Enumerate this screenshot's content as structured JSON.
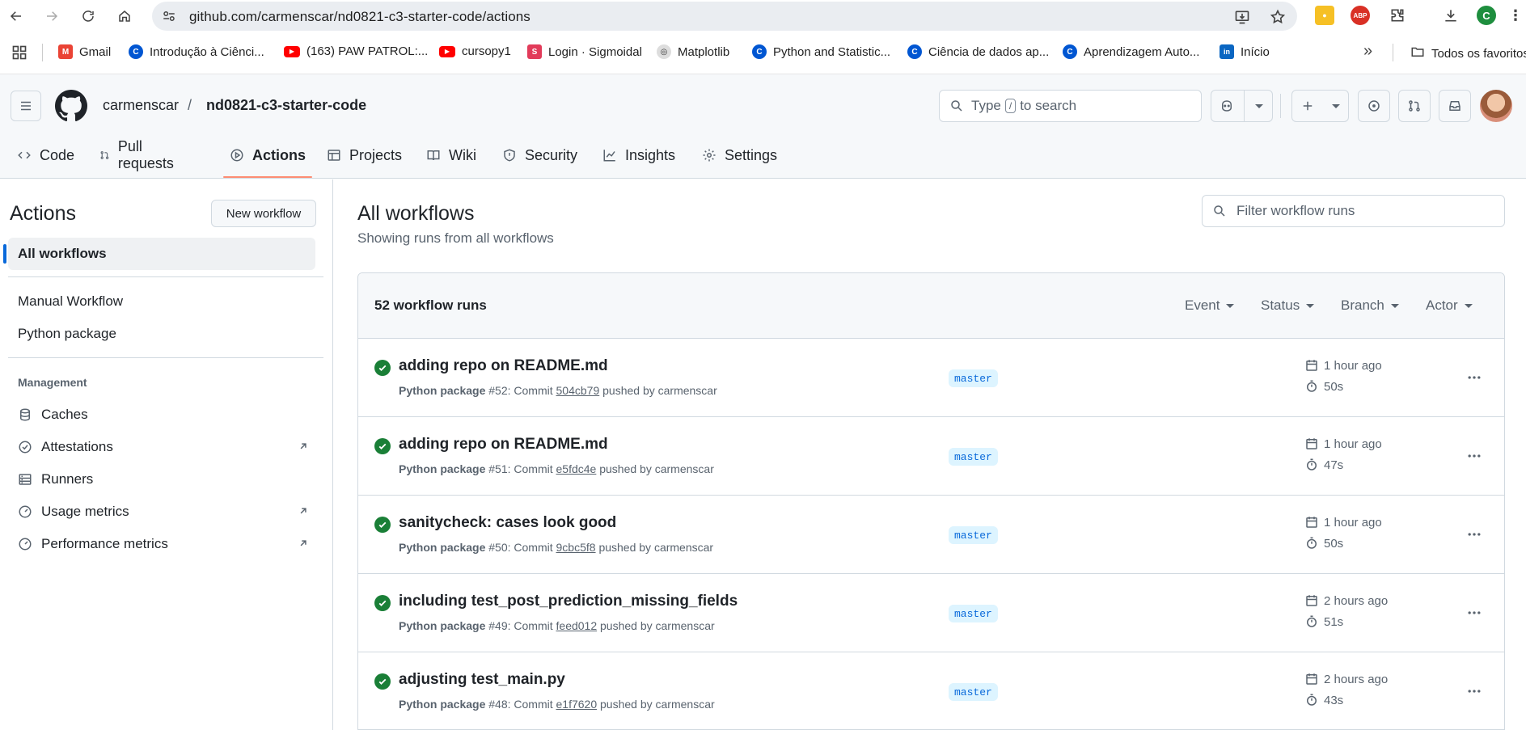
{
  "browser": {
    "url": "github.com/carmenscar/nd0821-c3-starter-code/actions",
    "profile_initial": "C",
    "bookmarks": [
      {
        "label": "Gmail",
        "icon": "gmail-icon"
      },
      {
        "label": "Introdução à Ciênci...",
        "icon": "coursera-icon"
      },
      {
        "label": "(163) PAW PATROL:...",
        "icon": "youtube-icon"
      },
      {
        "label": "cursopy1",
        "icon": "youtube-icon"
      },
      {
        "label": "Login · Sigmoidal",
        "icon": "sigmoidal-icon"
      },
      {
        "label": "Matplotlib",
        "icon": "matplotlib-icon"
      },
      {
        "label": "Python and Statistic...",
        "icon": "coursera-icon"
      },
      {
        "label": "Ciência de dados ap...",
        "icon": "coursera-icon"
      },
      {
        "label": "Aprendizagem Auto...",
        "icon": "coursera-icon"
      },
      {
        "label": "Início",
        "icon": "linkedin-icon"
      }
    ],
    "more_bookmarks": "»",
    "all_bookmarks": "Todos os favoritos"
  },
  "header": {
    "owner": "carmenscar",
    "separator": "/",
    "repo": "nd0821-c3-starter-code",
    "search_before": "Type",
    "search_key": "/",
    "search_after": "to search"
  },
  "tabs": [
    {
      "label": "Code",
      "icon": "code-icon"
    },
    {
      "label": "Pull requests",
      "icon": "pull-request-icon"
    },
    {
      "label": "Actions",
      "icon": "play-icon"
    },
    {
      "label": "Projects",
      "icon": "table-icon"
    },
    {
      "label": "Wiki",
      "icon": "book-icon"
    },
    {
      "label": "Security",
      "icon": "shield-icon"
    },
    {
      "label": "Insights",
      "icon": "graph-icon"
    },
    {
      "label": "Settings",
      "icon": "gear-icon"
    }
  ],
  "sidebar": {
    "title": "Actions",
    "new_workflow": "New workflow",
    "all_workflows": "All workflows",
    "workflows": [
      "Manual Workflow",
      "Python package"
    ],
    "management_label": "Management",
    "management": [
      {
        "label": "Caches",
        "icon": "database-icon",
        "external": false
      },
      {
        "label": "Attestations",
        "icon": "verified-icon",
        "external": true
      },
      {
        "label": "Runners",
        "icon": "server-icon",
        "external": false
      },
      {
        "label": "Usage metrics",
        "icon": "meter-icon",
        "external": true
      },
      {
        "label": "Performance metrics",
        "icon": "meter-icon",
        "external": true
      }
    ]
  },
  "main": {
    "title": "All workflows",
    "subtitle": "Showing runs from all workflows",
    "filter_placeholder": "Filter workflow runs",
    "runs_count": "52 workflow runs",
    "filters": [
      "Event",
      "Status",
      "Branch",
      "Actor"
    ],
    "runs": [
      {
        "title": "adding repo on README.md",
        "workflow": "Python package",
        "number": "#52",
        "commit_label": ": Commit",
        "sha": "504cb79",
        "pushed": "pushed by carmenscar",
        "branch": "master",
        "when": "1 hour ago",
        "duration": "50s"
      },
      {
        "title": "adding repo on README.md",
        "workflow": "Python package",
        "number": "#51",
        "commit_label": ": Commit",
        "sha": "e5fdc4e",
        "pushed": "pushed by carmenscar",
        "branch": "master",
        "when": "1 hour ago",
        "duration": "47s"
      },
      {
        "title": "sanitycheck: cases look good",
        "workflow": "Python package",
        "number": "#50",
        "commit_label": ": Commit",
        "sha": "9cbc5f8",
        "pushed": "pushed by carmenscar",
        "branch": "master",
        "when": "1 hour ago",
        "duration": "50s"
      },
      {
        "title": "including test_post_prediction_missing_fields",
        "workflow": "Python package",
        "number": "#49",
        "commit_label": ": Commit",
        "sha": "feed012",
        "pushed": "pushed by carmenscar",
        "branch": "master",
        "when": "2 hours ago",
        "duration": "51s"
      },
      {
        "title": "adjusting test_main.py",
        "workflow": "Python package",
        "number": "#48",
        "commit_label": ": Commit",
        "sha": "e1f7620",
        "pushed": "pushed by carmenscar",
        "branch": "master",
        "when": "2 hours ago",
        "duration": "43s"
      }
    ]
  },
  "colors": {
    "success": "#1a7f37",
    "accent_underline": "#fd8c73",
    "link_blue": "#0969da"
  }
}
